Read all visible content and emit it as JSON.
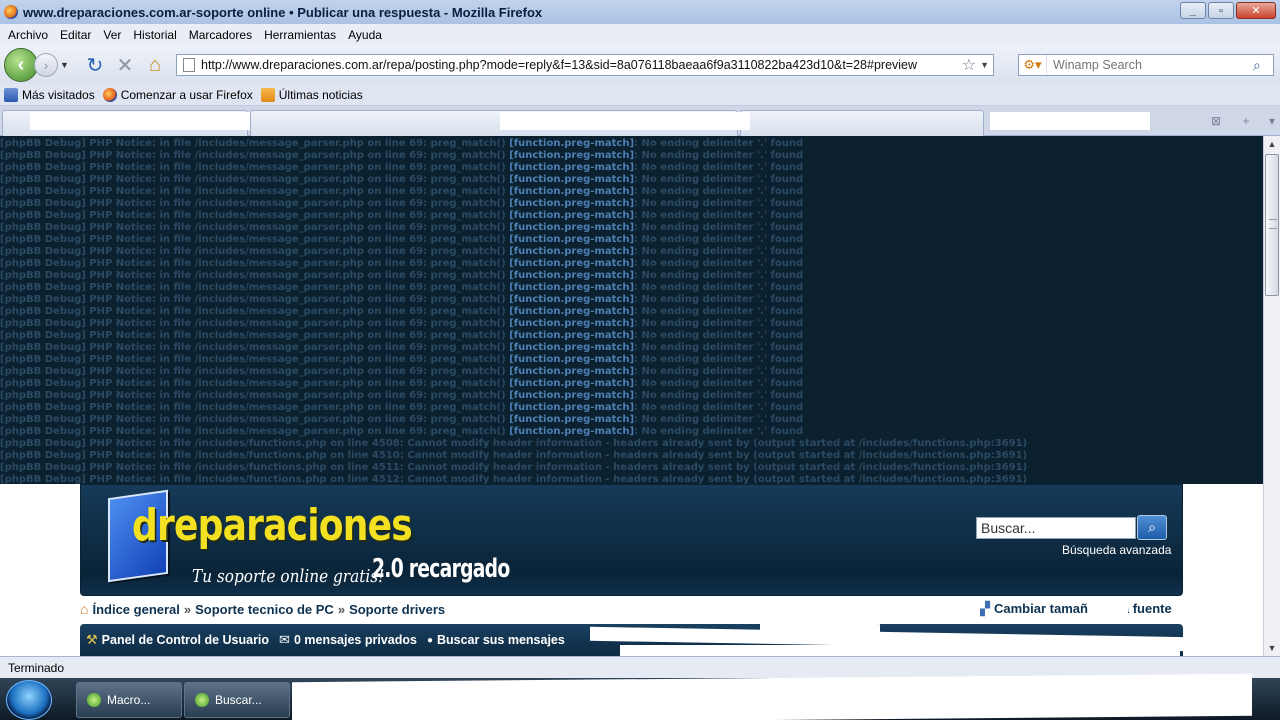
{
  "window": {
    "title": "www.dreparaciones.com.ar-soporte online • Publicar una respuesta - Mozilla Firefox",
    "controls": {
      "minimize": "_",
      "maximize": "▫",
      "close": "✕"
    }
  },
  "menubar": [
    "Archivo",
    "Editar",
    "Ver",
    "Historial",
    "Marcadores",
    "Herramientas",
    "Ayuda"
  ],
  "navbar": {
    "url": "http://www.dreparaciones.com.ar/repa/posting.php?mode=reply&f=13&sid=8a076118baeaa6f9a3110822ba423d10&t=28#preview",
    "search_placeholder": "Winamp Search"
  },
  "bookmarks": [
    {
      "label": "Más visitados",
      "icon": "bookmark-icon"
    },
    {
      "label": "Comenzar a usar Firefox",
      "icon": "firefox-icon"
    },
    {
      "label": "Últimas noticias",
      "icon": "rss-icon"
    }
  ],
  "debug": {
    "notice_prefix": "[phpBB Debug] PHP Notice:",
    "parser": {
      "in_file": "in file",
      "file": "/includes/message_parser.php",
      "on_line": "on line",
      "line": "69:",
      "call": "preg_match()",
      "link": "[function.preg-match]",
      "message": ": No ending delimiter '.' found",
      "count": 25
    },
    "functions": {
      "in_file": "in file",
      "file": "/includes/functions.php",
      "on_line": "on line",
      "message": ": Cannot modify header information - headers already sent by (output started at /includes/functions.php:3691)",
      "lines": [
        "4508",
        "4510",
        "4511",
        "4512"
      ]
    }
  },
  "forum": {
    "logo": {
      "name": "dreparaciones",
      "slogan": "Tu soporte online gratis!",
      "version": "2.0 recargado"
    },
    "search_value": "Buscar...",
    "search_button_icon": "search-icon",
    "advanced_search": "Búsqueda avanzada",
    "breadcrumbs": [
      "Índice general",
      "Soporte tecnico de PC",
      "Soporte drivers"
    ],
    "breadcrumb_sep": "»",
    "font_size": "Cambiar tamaño de la fuente",
    "nav": [
      {
        "label": "Panel de Control de Usuario",
        "icon": "user-cp-icon"
      },
      {
        "label": "0 mensajes privados",
        "icon": "mail-icon"
      },
      {
        "label": "Buscar sus mensajes",
        "icon": "bullet-icon"
      }
    ]
  },
  "status": "Terminado",
  "taskbar": [
    {
      "label": "Macro..."
    },
    {
      "label": "Buscar..."
    }
  ]
}
